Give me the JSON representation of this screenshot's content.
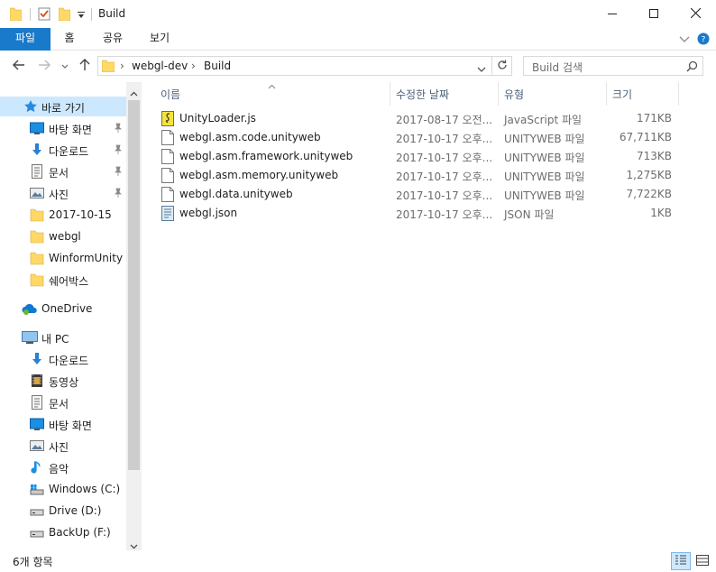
{
  "window": {
    "title": "Build",
    "controls": {
      "minimize": "minimize-icon",
      "maximize": "maximize-icon",
      "close": "close-icon"
    }
  },
  "ribbon": {
    "tabs": [
      {
        "label": "파일",
        "active": true
      },
      {
        "label": "홈",
        "active": false
      },
      {
        "label": "공유",
        "active": false
      },
      {
        "label": "보기",
        "active": false
      }
    ]
  },
  "address": {
    "breadcrumbs": [
      "webgl-dev",
      "Build"
    ]
  },
  "search": {
    "placeholder": "Build 검색"
  },
  "navigation": {
    "quick_access": "바로 가기",
    "pinned": [
      {
        "label": "바탕 화면",
        "icon": "desktop-icon",
        "pinned": true
      },
      {
        "label": "다운로드",
        "icon": "download-icon",
        "pinned": true
      },
      {
        "label": "문서",
        "icon": "document-icon",
        "pinned": true
      },
      {
        "label": "사진",
        "icon": "picture-icon",
        "pinned": true
      },
      {
        "label": "2017-10-15",
        "icon": "folder-icon",
        "pinned": false
      },
      {
        "label": "webgl",
        "icon": "folder-icon",
        "pinned": false
      },
      {
        "label": "WinformUnity",
        "icon": "folder-icon",
        "pinned": false
      },
      {
        "label": "쉐어박스",
        "icon": "folder-icon",
        "pinned": false
      }
    ],
    "onedrive": "OneDrive",
    "this_pc": "내 PC",
    "pc_items": [
      {
        "label": "다운로드",
        "icon": "download-icon"
      },
      {
        "label": "동영상",
        "icon": "video-icon"
      },
      {
        "label": "문서",
        "icon": "document-icon"
      },
      {
        "label": "바탕 화면",
        "icon": "desktop-icon"
      },
      {
        "label": "사진",
        "icon": "picture-icon"
      },
      {
        "label": "음악",
        "icon": "music-icon"
      },
      {
        "label": "Windows (C:)",
        "icon": "drive-c-icon"
      },
      {
        "label": "Drive (D:)",
        "icon": "drive-icon"
      },
      {
        "label": "BackUp (F:)",
        "icon": "drive-icon"
      }
    ]
  },
  "columns": {
    "name": "이름",
    "modified": "수정한 날짜",
    "type": "유형",
    "size": "크기"
  },
  "files": [
    {
      "name": "UnityLoader.js",
      "modified": "2017-08-17 오전...",
      "type": "JavaScript 파일",
      "size": "171KB",
      "icon": "javascript-file-icon"
    },
    {
      "name": "webgl.asm.code.unityweb",
      "modified": "2017-10-17 오후...",
      "type": "UNITYWEB 파일",
      "size": "67,711KB",
      "icon": "file-icon"
    },
    {
      "name": "webgl.asm.framework.unityweb",
      "modified": "2017-10-17 오후...",
      "type": "UNITYWEB 파일",
      "size": "713KB",
      "icon": "file-icon"
    },
    {
      "name": "webgl.asm.memory.unityweb",
      "modified": "2017-10-17 오후...",
      "type": "UNITYWEB 파일",
      "size": "1,275KB",
      "icon": "file-icon"
    },
    {
      "name": "webgl.data.unityweb",
      "modified": "2017-10-17 오후...",
      "type": "UNITYWEB 파일",
      "size": "7,722KB",
      "icon": "file-icon"
    },
    {
      "name": "webgl.json",
      "modified": "2017-10-17 오후...",
      "type": "JSON 파일",
      "size": "1KB",
      "icon": "json-file-icon"
    }
  ],
  "status": {
    "item_count": "6개 항목"
  },
  "colors": {
    "ribbon_active": "#1979ca",
    "selected_nav": "#cce8ff",
    "folder": "#ffd866",
    "header_text": "#4c607a"
  }
}
